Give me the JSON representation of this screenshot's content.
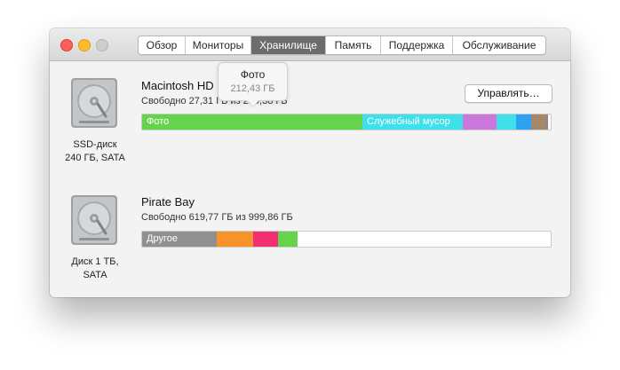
{
  "window": {
    "tabs": [
      {
        "label": "Обзор"
      },
      {
        "label": "Мониторы"
      },
      {
        "label": "Хранилище"
      },
      {
        "label": "Память"
      },
      {
        "label": "Поддержка"
      },
      {
        "label": "Обслуживание"
      }
    ],
    "active_tab_index": 2
  },
  "disks": [
    {
      "icon": "hard-drive-icon",
      "label_line1": "SSD-диск",
      "label_line2": "240 ГБ, SATA",
      "volume_name": "Macintosh HD",
      "free_text": "Свободно 27,31 ГБ из 239,38 ГБ",
      "manage_button": "Управлять…",
      "segments": [
        {
          "label": "Фото",
          "fraction": 0.54,
          "color": "#66d34c"
        },
        {
          "label": "Служебный мусор",
          "fraction": 0.245,
          "color": "#3ee0ea"
        },
        {
          "label": "",
          "fraction": 0.083,
          "color": "#cc77dd"
        },
        {
          "label": "",
          "fraction": 0.047,
          "color": "#3ee0ea"
        },
        {
          "label": "",
          "fraction": 0.037,
          "color": "#2ea1f0"
        },
        {
          "label": "",
          "fraction": 0.038,
          "color": "#a6886a"
        },
        {
          "label": "",
          "fraction": 0.004,
          "color": "#8a8a8a"
        }
      ]
    },
    {
      "icon": "hard-drive-icon",
      "label_line1": "Диск 1 ТБ,",
      "label_line2": "SATA",
      "volume_name": "Pirate Bay",
      "free_text": "Свободно 619,77 ГБ из 999,86 ГБ",
      "segments": [
        {
          "label": "Другое",
          "fraction": 0.183,
          "color": "#909090"
        },
        {
          "label": "",
          "fraction": 0.09,
          "color": "#f7932a"
        },
        {
          "label": "",
          "fraction": 0.06,
          "color": "#f42e72"
        },
        {
          "label": "",
          "fraction": 0.047,
          "color": "#66d34c"
        }
      ]
    }
  ],
  "tooltip": {
    "title": "Фото",
    "size": "212,43 ГБ"
  }
}
